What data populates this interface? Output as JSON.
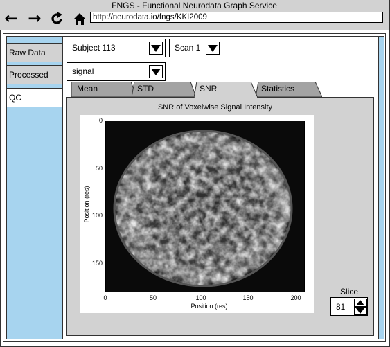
{
  "window": {
    "title": "FNGS - Functional Neurodata Graph Service"
  },
  "nav": {
    "url": "http://neurodata.io/fngs/KKI2009",
    "back_icon": "arrow-left-icon",
    "forward_icon": "arrow-right-icon",
    "reload_icon": "reload-icon",
    "home_icon": "home-icon"
  },
  "sidebar": {
    "items": [
      {
        "label": "Raw Data",
        "active": false
      },
      {
        "label": "Processed",
        "active": false
      },
      {
        "label": "QC",
        "active": true
      }
    ]
  },
  "selectors": {
    "subject": "Subject 113",
    "scan": "Scan 1",
    "measure": "signal"
  },
  "tabs": [
    {
      "label": "Mean",
      "active": false
    },
    {
      "label": "STD",
      "active": false
    },
    {
      "label": "SNR",
      "active": true
    },
    {
      "label": "Statistics",
      "active": false
    }
  ],
  "plot": {
    "title": "SNR of Voxelwise Signal Intensity",
    "xlabel": "Position (res)",
    "ylabel": "Position (res)",
    "xticks": [
      "0",
      "50",
      "100",
      "150",
      "200"
    ],
    "yticks": [
      "0",
      "50",
      "100",
      "150"
    ]
  },
  "slice": {
    "label": "Slice",
    "value": "81"
  },
  "colors": {
    "chrome": "#d2d2d2",
    "sidebar_blue": "#a7d4ef",
    "active_tab": "#d2d2d2",
    "inactive_tab": "#a3a3a3"
  }
}
